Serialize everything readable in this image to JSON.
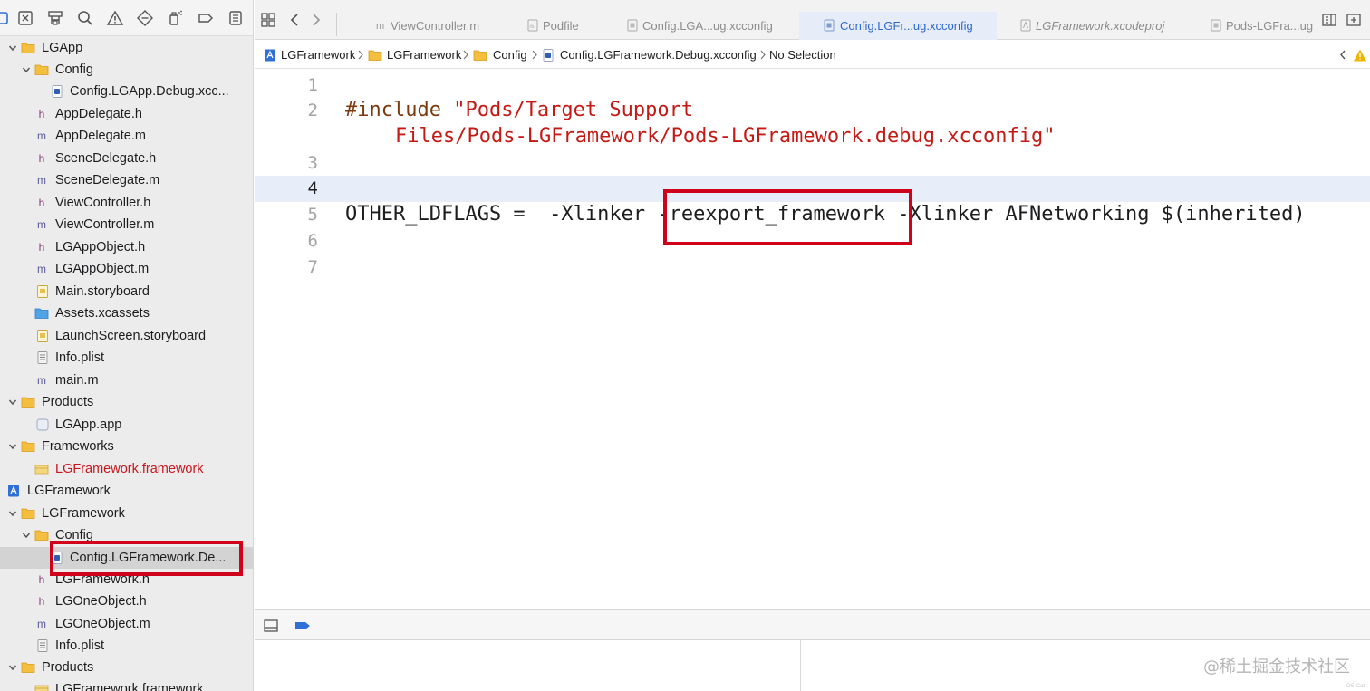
{
  "navigator": {
    "toolbar_icons": [
      "sidebar-close-icon",
      "hierarchy-icon",
      "search-icon",
      "warning-icon",
      "breakpoint-diamond-icon",
      "spray-icon",
      "tag-icon",
      "report-icon"
    ],
    "items": [
      {
        "label": "LGApp",
        "icon": "folder-icon",
        "level": 1,
        "expanded": true
      },
      {
        "label": "Config",
        "icon": "folder-icon",
        "level": 2,
        "expanded": true
      },
      {
        "label": "Config.LGApp.Debug.xcc...",
        "icon": "xcconfig-file-icon",
        "level": 3
      },
      {
        "label": "AppDelegate.h",
        "icon": "h",
        "level": 2
      },
      {
        "label": "AppDelegate.m",
        "icon": "m",
        "level": 2
      },
      {
        "label": "SceneDelegate.h",
        "icon": "h",
        "level": 2
      },
      {
        "label": "SceneDelegate.m",
        "icon": "m",
        "level": 2
      },
      {
        "label": "ViewController.h",
        "icon": "h",
        "level": 2
      },
      {
        "label": "ViewController.m",
        "icon": "m",
        "level": 2
      },
      {
        "label": "LGAppObject.h",
        "icon": "h",
        "level": 2
      },
      {
        "label": "LGAppObject.m",
        "icon": "m",
        "level": 2
      },
      {
        "label": "Main.storyboard",
        "icon": "storyboard-icon",
        "level": 2
      },
      {
        "label": "Assets.xcassets",
        "icon": "assets-folder-icon",
        "level": 2
      },
      {
        "label": "LaunchScreen.storyboard",
        "icon": "storyboard-icon",
        "level": 2
      },
      {
        "label": "Info.plist",
        "icon": "plist-icon",
        "level": 2
      },
      {
        "label": "main.m",
        "icon": "m",
        "level": 2
      },
      {
        "label": "Products",
        "icon": "folder-icon",
        "level": 1,
        "expanded": true
      },
      {
        "label": "LGApp.app",
        "icon": "app-icon",
        "level": 2
      },
      {
        "label": "Frameworks",
        "icon": "folder-icon",
        "level": 1,
        "expanded": true
      },
      {
        "label": "LGFramework.framework",
        "icon": "framework-icon",
        "level": 2,
        "red": true
      },
      {
        "label": "LGFramework",
        "icon": "project-icon",
        "level": 0,
        "expanded": true
      },
      {
        "label": "LGFramework",
        "icon": "folder-icon",
        "level": 1,
        "expanded": true
      },
      {
        "label": "Config",
        "icon": "folder-icon",
        "level": 2,
        "expanded": true
      },
      {
        "label": "Config.LGFramework.De...",
        "icon": "xcconfig-file-icon",
        "level": 3,
        "selected": true
      },
      {
        "label": "LGFramework.h",
        "icon": "h",
        "level": 2
      },
      {
        "label": "LGOneObject.h",
        "icon": "h",
        "level": 2
      },
      {
        "label": "LGOneObject.m",
        "icon": "m",
        "level": 2
      },
      {
        "label": "Info.plist",
        "icon": "plist-icon",
        "level": 2
      },
      {
        "label": "Products",
        "icon": "folder-icon",
        "level": 1,
        "expanded": true
      },
      {
        "label": "LGFramework.framework",
        "icon": "framework-icon",
        "level": 2
      }
    ]
  },
  "tabs": [
    {
      "label": "ViewController.m",
      "icon": "m-file-icon"
    },
    {
      "label": "Podfile",
      "icon": "rb-file-icon"
    },
    {
      "label": "Config.LGA...ug.xcconfig",
      "icon": "xcconfig-file-icon"
    },
    {
      "label": "Config.LGFr...ug.xcconfig",
      "icon": "xcconfig-file-icon",
      "active": true
    },
    {
      "label": "LGFramework.xcodeproj",
      "icon": "xcodeproj-icon",
      "italic": true
    },
    {
      "label": "Pods-LGFra...ug",
      "icon": "xcconfig-file-icon"
    }
  ],
  "jumpbar": {
    "crumbs": [
      "LGFramework",
      "LGFramework",
      "Config",
      "Config.LGFramework.Debug.xcconfig",
      "No Selection"
    ]
  },
  "editor": {
    "line_numbers": [
      "1",
      "2",
      "3",
      "4",
      "5",
      "6",
      "7"
    ],
    "current_line": "4",
    "include_keyword": "#include",
    "include_path_1": "\"Pods/Target Support",
    "include_path_2": "Files/Pods-LGFramework/Pods-LGFramework.debug.xcconfig\"",
    "line5_prefix": "OTHER_LDFLAGS =  -Xlinker ",
    "line5_highlight": "-reexport_framework",
    "line5_suffix": " -Xlinker AFNetworking $(inherited)"
  },
  "annotation_color": "#d0021b",
  "watermark": "@稀土掘金技术社区",
  "watermark_small": "iOS-Cat"
}
